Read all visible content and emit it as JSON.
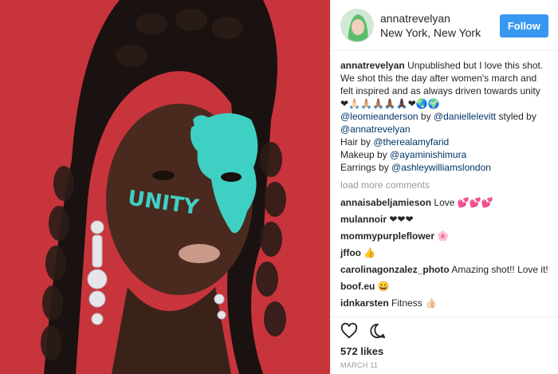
{
  "header": {
    "username": "annatrevelyan",
    "location": "New York, New York",
    "follow_label": "Follow"
  },
  "caption": {
    "username": "annatrevelyan",
    "text": "Unpublished but I love this shot. We shot this the day after women's march and felt inspired and as always driven towards unity ❤🙏🏻🙏🏼🙏🏽🙏🏾🙏🏿❤🌏🌍",
    "credit1_tag_a": "@leomieanderson",
    "credit1_mid": " by ",
    "credit1_tag_b": "@daniellelevitt",
    "credit1_tail": " styled by ",
    "credit1_tag_c": "@annatrevelyan",
    "hair_prefix": "Hair by ",
    "hair_tag": "@therealamyfarid",
    "makeup_prefix": "Makeup by ",
    "makeup_tag": "@ayaminishimura",
    "earrings_prefix": "Earrings by ",
    "earrings_tag": "@ashleywilliamslondon"
  },
  "load_more": "load more comments",
  "comments": [
    {
      "user": "annaisabeljamieson",
      "text": "Love 💕💕💕"
    },
    {
      "user": "mulannoir",
      "text": "❤❤❤"
    },
    {
      "user": "mommypurpleflower",
      "text": "🌸"
    },
    {
      "user": "jffoo",
      "text": "👍"
    },
    {
      "user": "carolinagonzalez_photo",
      "text": "Amazing shot!! Love it!"
    },
    {
      "user": "boof.eu",
      "text": "😀"
    },
    {
      "user": "idnkarsten",
      "text": "Fitness 👍🏻"
    }
  ],
  "photo": {
    "face_text": "UNITY"
  },
  "likes": "572 likes",
  "date": "MARCH 11",
  "icons": [
    "heart-icon",
    "comment-icon"
  ],
  "colors": {
    "follow_button": "#3897f0",
    "mention": "#003569",
    "photo_background": "#c8343c",
    "face_paint": "#3fd0c4"
  }
}
